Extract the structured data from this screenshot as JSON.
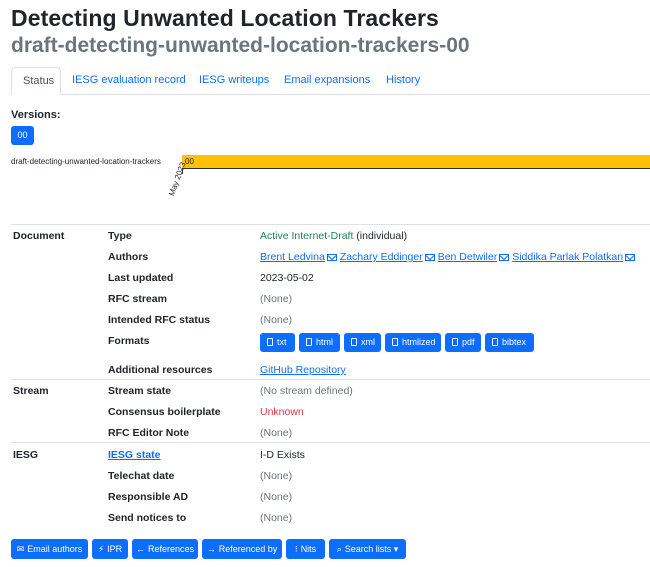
{
  "header": {
    "title": "Detecting Unwanted Location Trackers",
    "subtitle": "draft-detecting-unwanted-location-trackers-00"
  },
  "tabs": [
    {
      "label": "Status"
    },
    {
      "label": "IESG evaluation record"
    },
    {
      "label": "IESG writeups"
    },
    {
      "label": "Email expansions"
    },
    {
      "label": "History"
    }
  ],
  "versions": {
    "label": "Versions:",
    "items": [
      "00"
    ]
  },
  "timeline": {
    "draft_name": "draft-detecting-unwanted-location-trackers",
    "bar_label": "00",
    "date_label": "May 2023"
  },
  "document": {
    "section": "Document",
    "type_label": "Type",
    "type_value": "Active Internet-Draft",
    "type_suffix": "(individual)",
    "authors_label": "Authors",
    "authors": [
      "Brent Ledvina",
      "Zachary Eddinger",
      "Ben Detwiler",
      "Siddika Parlak Polatkan"
    ],
    "last_updated_label": "Last updated",
    "last_updated": "2023-05-02",
    "rfc_stream_label": "RFC stream",
    "rfc_stream": "(None)",
    "intended_status_label": "Intended RFC status",
    "intended_status": "(None)",
    "formats_label": "Formats",
    "formats": [
      "txt",
      "html",
      "xml",
      "htmlized",
      "pdf",
      "bibtex"
    ],
    "resources_label": "Additional resources",
    "resources_link": "GitHub Repository"
  },
  "stream": {
    "section": "Stream",
    "state_label": "Stream state",
    "state": "(No stream defined)",
    "consensus_label": "Consensus boilerplate",
    "consensus": "Unknown",
    "rfc_editor_label": "RFC Editor Note",
    "rfc_editor": "(None)"
  },
  "iesg": {
    "section": "IESG",
    "state_label": "IESG state",
    "state": "I-D Exists",
    "telechat_label": "Telechat date",
    "telechat": "(None)",
    "ad_label": "Responsible AD",
    "ad": "(None)",
    "notices_label": "Send notices to",
    "notices": "(None)"
  },
  "actions": [
    {
      "glyph": "✉",
      "label": "Email authors"
    },
    {
      "glyph": "⚡",
      "label": "IPR"
    },
    {
      "glyph": "←",
      "label": "References"
    },
    {
      "glyph": "→",
      "label": "Referenced by"
    },
    {
      "glyph": "⁝",
      "label": "Nits"
    },
    {
      "glyph": "⌕",
      "label": "Search lists",
      "caret": "▾"
    }
  ],
  "colors": {
    "primary": "#0d6efd",
    "timeline_bar": "#ffc107",
    "active_state": "#198754",
    "unknown_state": "#dc3545"
  }
}
